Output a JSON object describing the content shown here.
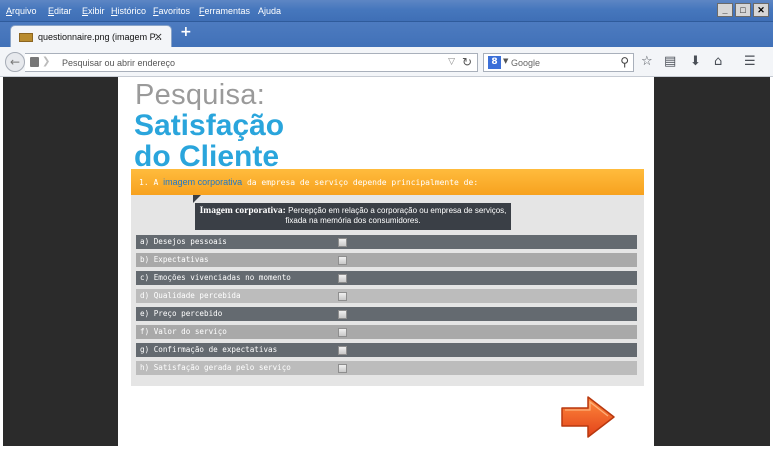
{
  "browser": {
    "menu": [
      "Arquivo",
      "Editar",
      "Exibir",
      "Histórico",
      "Favoritos",
      "Ferramentas",
      "Ajuda"
    ],
    "window_buttons": [
      "_",
      "°",
      "✕"
    ],
    "tab": {
      "title": "questionnaire.png (imagem P...",
      "close": "×"
    },
    "new_tab": "+",
    "address": {
      "placeholder": "Pesquisar ou abrir endereço"
    },
    "search": {
      "engine": "Google",
      "placeholder": "Google"
    }
  },
  "page": {
    "title_line1": "Pesquisa:",
    "title_line2": "Satisfação",
    "title_line3": "do Cliente",
    "question": {
      "number": "1. A ",
      "highlight": "imagem corporativa",
      "rest": " da empresa de serviço depende principalmente de:"
    },
    "tooltip": {
      "term": "Imagem corporativa:",
      "definition_line1": " Percepção em relação a corporação ou empresa de serviços,",
      "definition_line2": "fixada na memória dos consumidores."
    },
    "options": [
      {
        "label": "a) Desejos pessoais"
      },
      {
        "label": "b) Expectativas"
      },
      {
        "label": "c) Emoções vivenciadas no momento"
      },
      {
        "label": "d) Qualidade percebida"
      },
      {
        "label": "e) Preço percebido"
      },
      {
        "label": "f) Valor do serviço"
      },
      {
        "label": "g) Confirmação de expectativas"
      },
      {
        "label": "h) Satisfação gerada pelo serviço"
      }
    ],
    "colors": {
      "accent_blue": "#2aa5dc",
      "question_orange": "#f7a21f",
      "option_dark": "#646a70",
      "option_light": "#a9a9a9",
      "next_arrow": "#f05a1a"
    }
  }
}
